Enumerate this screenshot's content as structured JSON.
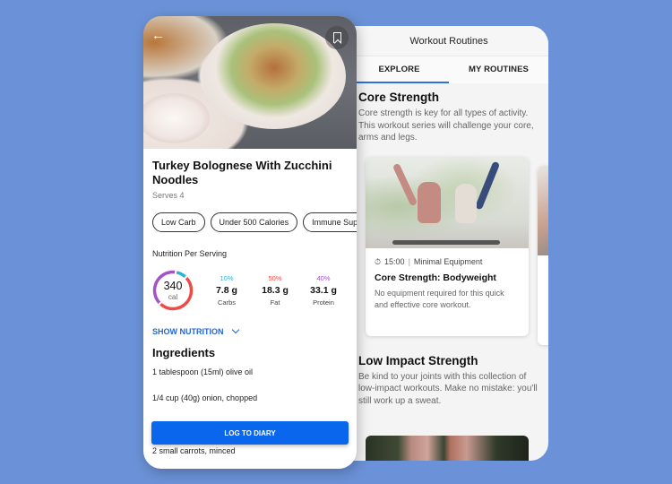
{
  "recipe": {
    "title": "Turkey Bolognese With Zucchini Noodles",
    "serves": "Serves 4",
    "tags": [
      "Low Carb",
      "Under 500 Calories",
      "Immune Sup"
    ],
    "nutrition_label": "Nutrition Per Serving",
    "calories": {
      "value": "340",
      "unit": "cal"
    },
    "macros": [
      {
        "percent": "10%",
        "value": "7.8 g",
        "label": "Carbs",
        "color": "#2bb3d6",
        "fraction": 0.1
      },
      {
        "percent": "50%",
        "value": "18.3 g",
        "label": "Fat",
        "color": "#ef4a45",
        "fraction": 0.5
      },
      {
        "percent": "40%",
        "value": "33.1 g",
        "label": "Protein",
        "color": "#a653c9",
        "fraction": 0.4
      }
    ],
    "show_nutrition": "SHOW NUTRITION",
    "ingredients_title": "Ingredients",
    "ingredients": [
      "1 tablespoon (15ml) olive oil",
      "1/4 cup (40g) onion, chopped",
      "2 small carrots, minced"
    ],
    "log_button": "LOG TO DIARY",
    "icons": {
      "back": "arrow-left-icon",
      "bookmark": "bookmark-icon"
    }
  },
  "workout": {
    "header_title": "Workout Routines",
    "tabs": [
      {
        "label": "EXPLORE",
        "active": true
      },
      {
        "label": "MY ROUTINES",
        "active": false
      }
    ],
    "sections": [
      {
        "title": "Core Strength",
        "description": "Core strength is key for all types of activity. This workout series will challenge your core, arms and legs.",
        "card": {
          "duration": "15:00",
          "equipment": "Minimal Equipment",
          "title": "Core Strength: Bodyweight",
          "description": "No equipment required for this quick and effective core workout."
        }
      },
      {
        "title": "Low Impact Strength",
        "description": "Be kind to your joints with this collection of low-impact workouts. Make no mistake: you'll still work up a sweat."
      }
    ]
  },
  "colors": {
    "background": "#6b92d8",
    "accent": "#0b66ee",
    "tab_indicator": "#2f6fe0"
  }
}
